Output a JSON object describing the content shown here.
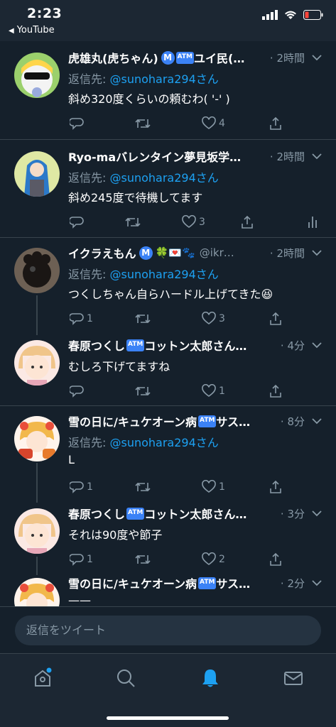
{
  "status_bar": {
    "time": "2:23",
    "back_label": "YouTube"
  },
  "tweets": [
    {
      "name": "虎雄丸(虎ちゃん)",
      "badges": [
        "M",
        "ATM"
      ],
      "name_suffix": "ユイ民(…",
      "handle": "",
      "time": "· 2時間",
      "reply_prefix": "返信先: ",
      "reply_mention": "@sunohara294さん",
      "text": "斜め320度くらいの頼むわ( '-' )",
      "replies": "",
      "retweets": "",
      "likes": "4"
    },
    {
      "name": "Ryo-maバレンタイン夢見坂学…",
      "badges": [],
      "name_suffix": "",
      "handle": "",
      "time": "· 2時間",
      "reply_prefix": "返信先: ",
      "reply_mention": "@sunohara294さん",
      "text": "斜め245度で待機してます",
      "replies": "",
      "retweets": "",
      "likes": "3"
    },
    {
      "name": "イクラえもん",
      "badges": [
        "M"
      ],
      "name_suffix": "🍀💌🐾",
      "handle": "@ikr…",
      "time": "· 2時間",
      "reply_prefix": "返信先: ",
      "reply_mention": "@sunohara294さん",
      "text": "つくしちゃん自らハードル上げてきた😆",
      "replies": "1",
      "retweets": "",
      "likes": "3"
    },
    {
      "name": "春原つくし",
      "badges": [
        "ATM"
      ],
      "name_suffix": "コットン太郎さん#…",
      "handle": "",
      "time": "· 4分",
      "reply_prefix": "",
      "reply_mention": "",
      "text": "むしろ下げてますね",
      "replies": "",
      "retweets": "",
      "likes": "1"
    },
    {
      "name": "雪の日に/キュケオーン病",
      "badges": [
        "ATM"
      ],
      "name_suffix": "サス…",
      "handle": "",
      "time": "· 8分",
      "reply_prefix": "返信先: ",
      "reply_mention": "@sunohara294さん",
      "text": "L",
      "replies": "1",
      "retweets": "",
      "likes": "1"
    },
    {
      "name": "春原つくし",
      "badges": [
        "ATM"
      ],
      "name_suffix": "コットン太郎さん#…",
      "handle": "",
      "time": "· 3分",
      "reply_prefix": "",
      "reply_mention": "",
      "text": "それは90度や節子",
      "replies": "1",
      "retweets": "",
      "likes": "2"
    },
    {
      "name": "雪の日に/キュケオーン病",
      "badges": [
        "ATM"
      ],
      "name_suffix": "サス…",
      "handle": "",
      "time": "· 2分",
      "reply_prefix": "",
      "reply_mention": "",
      "text": "——",
      "replies": "",
      "retweets": "",
      "likes": ""
    }
  ],
  "reply_input": {
    "placeholder": "返信をツイート"
  },
  "tabs": [
    {
      "icon": "home-icon",
      "has_dot": true
    },
    {
      "icon": "search-icon",
      "has_dot": false
    },
    {
      "icon": "bell-icon",
      "active": true
    },
    {
      "icon": "mail-icon",
      "has_dot": false
    }
  ],
  "colors": {
    "background": "#15202b",
    "accent": "#1da1f2",
    "muted": "#8899a6",
    "divider": "#38444d"
  }
}
